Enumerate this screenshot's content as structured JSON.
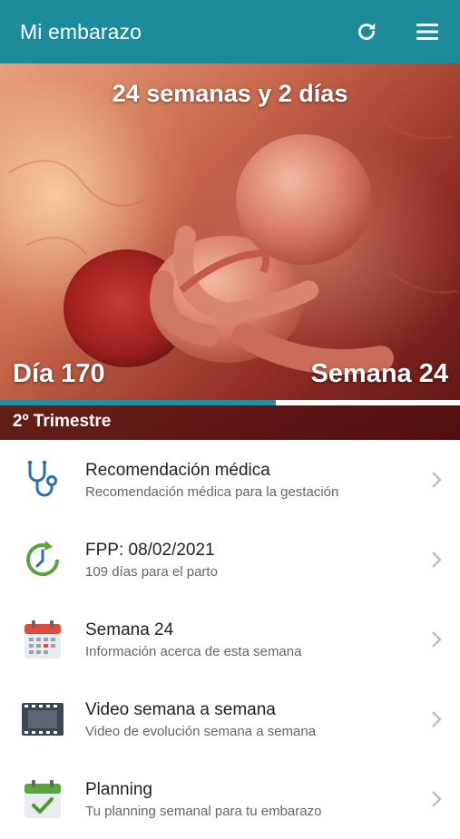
{
  "appbar": {
    "title": "Mi embarazo",
    "refresh_icon": "refresh-icon",
    "menu_icon": "menu-icon",
    "color": "#1b8a99"
  },
  "hero": {
    "weeks_text": "24 semanas y 2 días",
    "day_text": "Día 170",
    "week_text": "Semana 24",
    "trimester_text": "2º Trimestre",
    "progress_fraction": 0.6,
    "progress_color": "#1f8fa0"
  },
  "items": [
    {
      "title": "Recomendación médica",
      "subtitle": "Recomendación médica para la gestación",
      "icon": "stethoscope-icon"
    },
    {
      "title": "FPP: 08/02/2021",
      "subtitle": "109 días para el parto",
      "icon": "countdown-clock-icon"
    },
    {
      "title": "Semana 24",
      "subtitle": "Información acerca de esta semana",
      "icon": "calendar-icon"
    },
    {
      "title": "Video semana a semana",
      "subtitle": "Video de evolución semana a semana",
      "icon": "film-strip-icon"
    },
    {
      "title": "Planning",
      "subtitle": "Tu planning semanal para tu embarazo",
      "icon": "calendar-check-icon"
    }
  ]
}
